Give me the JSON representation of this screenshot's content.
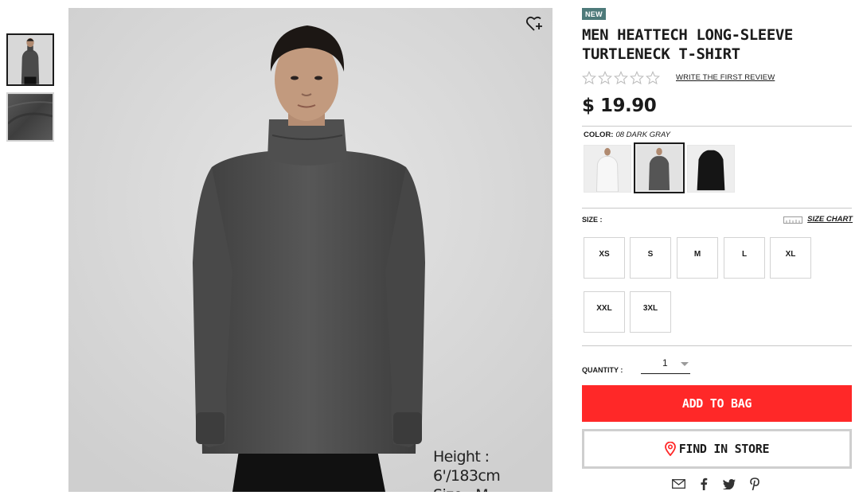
{
  "thumbnails": [
    {
      "icon": "model-photo-thumbnail",
      "selected": true
    },
    {
      "icon": "fabric-texture-thumbnail",
      "selected": false
    }
  ],
  "hero": {
    "favorite_icon": "heart-plus-icon",
    "model_height": "Height : 6'/183cm",
    "model_size": "Size : M"
  },
  "product": {
    "badge": "NEW",
    "title_line1": "MEN HEATTECH LONG-SLEEVE",
    "title_line2": "TURTLENECK T-SHIRT",
    "rating_stars": 0,
    "review_link": "WRITE THE FIRST REVIEW",
    "price": "$ 19.90"
  },
  "color": {
    "label": "COLOR:",
    "selected_value": "08 DARK GRAY",
    "options": [
      {
        "name": "white",
        "hex": "#f0f0f0"
      },
      {
        "name": "dark-gray",
        "hex": "#555555"
      },
      {
        "name": "black",
        "hex": "#151515"
      }
    ]
  },
  "size": {
    "label": "SIZE :",
    "chart_link": "SIZE CHART",
    "options": [
      "XS",
      "S",
      "M",
      "L",
      "XL",
      "XXL",
      "3XL"
    ]
  },
  "quantity": {
    "label": "QUANTITY :",
    "value": "1"
  },
  "actions": {
    "add_to_bag": "ADD TO BAG",
    "find_in_store": "FIND IN STORE"
  },
  "share_icons": [
    "email-icon",
    "facebook-icon",
    "twitter-icon",
    "pinterest-icon"
  ],
  "colors": {
    "accent_red": "#ff2828",
    "badge_teal": "#4d7a7a",
    "text": "#1b1b1b"
  }
}
